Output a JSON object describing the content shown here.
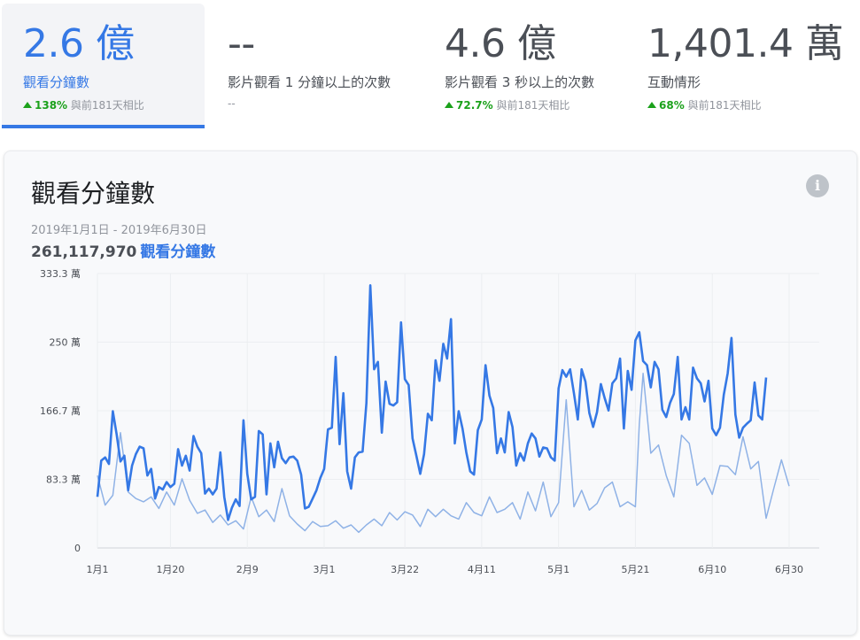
{
  "tiles": [
    {
      "value": "2.6 億",
      "label": "觀看分鐘數",
      "change": "138%",
      "compare": "與前181天相比"
    },
    {
      "value": "--",
      "label": "影片觀看 1 分鐘以上的次數",
      "sub": "--"
    },
    {
      "value": "4.6 億",
      "label": "影片觀看 3 秒以上的次數",
      "change": "72.7%",
      "compare": "與前181天相比"
    },
    {
      "value": "1,401.4 萬",
      "label": "互動情形",
      "change": "68%",
      "compare": "與前181天相比"
    }
  ],
  "panel": {
    "title": "觀看分鐘數",
    "info_glyph": "i",
    "date_range": "2019年1月1日 - 2019年6月30日",
    "total_value": "261,117,970",
    "total_unit": "觀看分鐘數"
  },
  "colors": {
    "accent": "#3578e5",
    "secondary": "#8fb2e6",
    "positive": "#1ba11b"
  },
  "chart_data": {
    "type": "line",
    "title": "",
    "xlabel": "",
    "ylabel": "",
    "ylim": [
      0,
      3333333
    ],
    "y_ticks": [
      {
        "value": 0,
        "label": "0"
      },
      {
        "value": 833333,
        "label": "83.3 萬"
      },
      {
        "value": 1666667,
        "label": "166.7 萬"
      },
      {
        "value": 2500000,
        "label": "250 萬"
      },
      {
        "value": 3333333,
        "label": "333.3 萬"
      }
    ],
    "x_ticks": [
      {
        "index": 0,
        "label": "1月1"
      },
      {
        "index": 19,
        "label": "1月20"
      },
      {
        "index": 39,
        "label": "2月9"
      },
      {
        "index": 59,
        "label": "3月1"
      },
      {
        "index": 80,
        "label": "3月22"
      },
      {
        "index": 100,
        "label": "4月11"
      },
      {
        "index": 120,
        "label": "5月1"
      },
      {
        "index": 140,
        "label": "5月21"
      },
      {
        "index": 160,
        "label": "6月10"
      },
      {
        "index": 180,
        "label": "6月30"
      }
    ],
    "x_start": "2019-01-01",
    "x_end": "2019-06-30",
    "grid": true,
    "anchors_current": [
      [
        0,
        620000
      ],
      [
        1,
        1060000
      ],
      [
        2,
        1100000
      ],
      [
        3,
        1020000
      ],
      [
        4,
        1660000
      ],
      [
        5,
        1380000
      ],
      [
        6,
        1050000
      ],
      [
        7,
        1120000
      ],
      [
        8,
        700000
      ],
      [
        9,
        1000000
      ],
      [
        10,
        1140000
      ],
      [
        11,
        1230000
      ],
      [
        12,
        1210000
      ],
      [
        13,
        880000
      ],
      [
        14,
        960000
      ],
      [
        15,
        600000
      ],
      [
        16,
        740000
      ],
      [
        17,
        710000
      ],
      [
        18,
        800000
      ],
      [
        19,
        740000
      ],
      [
        20,
        780000
      ],
      [
        21,
        1200000
      ],
      [
        22,
        1000000
      ],
      [
        23,
        1120000
      ],
      [
        24,
        940000
      ],
      [
        25,
        1360000
      ],
      [
        26,
        1230000
      ],
      [
        27,
        1150000
      ],
      [
        28,
        660000
      ],
      [
        29,
        720000
      ],
      [
        30,
        650000
      ],
      [
        31,
        720000
      ],
      [
        32,
        1160000
      ],
      [
        33,
        620000
      ],
      [
        34,
        340000
      ],
      [
        35,
        490000
      ],
      [
        36,
        590000
      ],
      [
        37,
        510000
      ],
      [
        38,
        1550000
      ],
      [
        39,
        900000
      ],
      [
        40,
        590000
      ],
      [
        41,
        620000
      ],
      [
        42,
        1420000
      ],
      [
        43,
        1380000
      ],
      [
        44,
        650000
      ],
      [
        45,
        1270000
      ],
      [
        46,
        980000
      ],
      [
        47,
        1290000
      ],
      [
        48,
        1090000
      ],
      [
        49,
        1030000
      ],
      [
        50,
        1100000
      ],
      [
        51,
        1110000
      ],
      [
        52,
        1060000
      ],
      [
        53,
        890000
      ],
      [
        54,
        480000
      ],
      [
        55,
        500000
      ],
      [
        56,
        600000
      ],
      [
        57,
        700000
      ],
      [
        58,
        850000
      ],
      [
        59,
        960000
      ],
      [
        60,
        1440000
      ],
      [
        61,
        1460000
      ],
      [
        62,
        2320000
      ],
      [
        63,
        1260000
      ],
      [
        64,
        1880000
      ],
      [
        65,
        930000
      ],
      [
        66,
        720000
      ],
      [
        67,
        1100000
      ],
      [
        68,
        1160000
      ],
      [
        69,
        1170000
      ],
      [
        70,
        1760000
      ],
      [
        71,
        3190000
      ],
      [
        72,
        2170000
      ],
      [
        73,
        2260000
      ],
      [
        74,
        1400000
      ],
      [
        75,
        2020000
      ],
      [
        76,
        1750000
      ],
      [
        77,
        1730000
      ],
      [
        78,
        1770000
      ],
      [
        79,
        2740000
      ],
      [
        80,
        2050000
      ],
      [
        81,
        1980000
      ],
      [
        82,
        1330000
      ],
      [
        83,
        1120000
      ],
      [
        84,
        900000
      ],
      [
        85,
        1140000
      ],
      [
        86,
        1630000
      ],
      [
        87,
        1550000
      ],
      [
        88,
        2280000
      ],
      [
        89,
        2030000
      ],
      [
        90,
        2480000
      ],
      [
        91,
        2300000
      ],
      [
        92,
        2780000
      ],
      [
        93,
        1270000
      ],
      [
        94,
        1660000
      ],
      [
        95,
        1450000
      ],
      [
        96,
        1160000
      ],
      [
        97,
        930000
      ],
      [
        98,
        890000
      ],
      [
        99,
        1430000
      ],
      [
        100,
        1560000
      ],
      [
        101,
        2220000
      ],
      [
        102,
        1850000
      ],
      [
        103,
        1700000
      ],
      [
        104,
        1150000
      ],
      [
        105,
        1330000
      ],
      [
        106,
        1160000
      ],
      [
        107,
        1650000
      ],
      [
        108,
        1470000
      ],
      [
        109,
        1000000
      ],
      [
        110,
        1150000
      ],
      [
        111,
        1060000
      ],
      [
        112,
        1270000
      ],
      [
        113,
        1390000
      ],
      [
        114,
        1330000
      ],
      [
        115,
        1110000
      ],
      [
        116,
        1220000
      ],
      [
        117,
        1210000
      ],
      [
        118,
        1100000
      ],
      [
        119,
        1060000
      ],
      [
        120,
        1940000
      ],
      [
        121,
        2160000
      ],
      [
        122,
        2080000
      ],
      [
        123,
        2170000
      ],
      [
        124,
        1880000
      ],
      [
        125,
        1560000
      ],
      [
        126,
        2170000
      ],
      [
        127,
        2020000
      ],
      [
        128,
        1640000
      ],
      [
        129,
        1470000
      ],
      [
        130,
        1650000
      ],
      [
        131,
        1990000
      ],
      [
        132,
        1820000
      ],
      [
        133,
        1670000
      ],
      [
        134,
        2000000
      ],
      [
        135,
        2060000
      ],
      [
        136,
        2300000
      ],
      [
        137,
        1450000
      ],
      [
        138,
        2150000
      ],
      [
        139,
        1920000
      ],
      [
        140,
        2520000
      ],
      [
        141,
        2620000
      ],
      [
        142,
        2270000
      ],
      [
        143,
        2220000
      ],
      [
        144,
        1950000
      ],
      [
        145,
        2260000
      ],
      [
        146,
        2170000
      ],
      [
        147,
        1680000
      ],
      [
        148,
        1590000
      ],
      [
        149,
        1760000
      ],
      [
        150,
        1870000
      ],
      [
        151,
        2320000
      ],
      [
        152,
        1560000
      ],
      [
        153,
        1710000
      ],
      [
        154,
        1560000
      ],
      [
        155,
        2190000
      ],
      [
        156,
        2060000
      ],
      [
        157,
        2000000
      ],
      [
        158,
        1780000
      ],
      [
        159,
        2030000
      ],
      [
        160,
        1450000
      ],
      [
        161,
        1370000
      ],
      [
        162,
        1460000
      ],
      [
        163,
        1860000
      ],
      [
        164,
        2120000
      ],
      [
        165,
        2550000
      ],
      [
        166,
        1620000
      ],
      [
        167,
        1340000
      ],
      [
        168,
        1460000
      ],
      [
        169,
        1510000
      ],
      [
        170,
        1550000
      ],
      [
        171,
        2010000
      ],
      [
        172,
        1610000
      ],
      [
        173,
        1560000
      ],
      [
        174,
        2070000
      ]
    ],
    "anchors_previous": [
      [
        0,
        880000
      ],
      [
        2,
        520000
      ],
      [
        4,
        640000
      ],
      [
        6,
        1400000
      ],
      [
        8,
        680000
      ],
      [
        10,
        600000
      ],
      [
        12,
        560000
      ],
      [
        14,
        620000
      ],
      [
        16,
        480000
      ],
      [
        18,
        680000
      ],
      [
        20,
        520000
      ],
      [
        22,
        840000
      ],
      [
        24,
        580000
      ],
      [
        26,
        420000
      ],
      [
        28,
        460000
      ],
      [
        30,
        310000
      ],
      [
        32,
        400000
      ],
      [
        34,
        280000
      ],
      [
        36,
        330000
      ],
      [
        38,
        230000
      ],
      [
        40,
        620000
      ],
      [
        42,
        380000
      ],
      [
        44,
        460000
      ],
      [
        46,
        320000
      ],
      [
        48,
        720000
      ],
      [
        50,
        390000
      ],
      [
        52,
        290000
      ],
      [
        54,
        210000
      ],
      [
        56,
        320000
      ],
      [
        58,
        260000
      ],
      [
        60,
        270000
      ],
      [
        62,
        330000
      ],
      [
        64,
        240000
      ],
      [
        66,
        280000
      ],
      [
        68,
        190000
      ],
      [
        70,
        280000
      ],
      [
        72,
        350000
      ],
      [
        74,
        270000
      ],
      [
        76,
        430000
      ],
      [
        78,
        340000
      ],
      [
        80,
        440000
      ],
      [
        82,
        400000
      ],
      [
        84,
        260000
      ],
      [
        86,
        470000
      ],
      [
        88,
        380000
      ],
      [
        90,
        470000
      ],
      [
        92,
        390000
      ],
      [
        94,
        350000
      ],
      [
        96,
        550000
      ],
      [
        98,
        430000
      ],
      [
        100,
        390000
      ],
      [
        102,
        620000
      ],
      [
        104,
        430000
      ],
      [
        106,
        470000
      ],
      [
        108,
        550000
      ],
      [
        110,
        350000
      ],
      [
        112,
        680000
      ],
      [
        114,
        450000
      ],
      [
        116,
        800000
      ],
      [
        118,
        380000
      ],
      [
        120,
        550000
      ],
      [
        122,
        1800000
      ],
      [
        124,
        500000
      ],
      [
        126,
        700000
      ],
      [
        128,
        460000
      ],
      [
        130,
        540000
      ],
      [
        132,
        730000
      ],
      [
        134,
        800000
      ],
      [
        136,
        500000
      ],
      [
        138,
        560000
      ],
      [
        140,
        500000
      ],
      [
        141,
        1500000
      ],
      [
        142,
        2120000
      ],
      [
        144,
        1150000
      ],
      [
        146,
        1250000
      ],
      [
        148,
        880000
      ],
      [
        150,
        620000
      ],
      [
        152,
        1370000
      ],
      [
        154,
        1270000
      ],
      [
        156,
        760000
      ],
      [
        158,
        850000
      ],
      [
        160,
        650000
      ],
      [
        162,
        1000000
      ],
      [
        164,
        990000
      ],
      [
        166,
        890000
      ],
      [
        168,
        1350000
      ],
      [
        170,
        960000
      ],
      [
        172,
        1050000
      ],
      [
        174,
        360000
      ],
      [
        176,
        720000
      ],
      [
        178,
        1070000
      ],
      [
        180,
        750000
      ]
    ]
  }
}
